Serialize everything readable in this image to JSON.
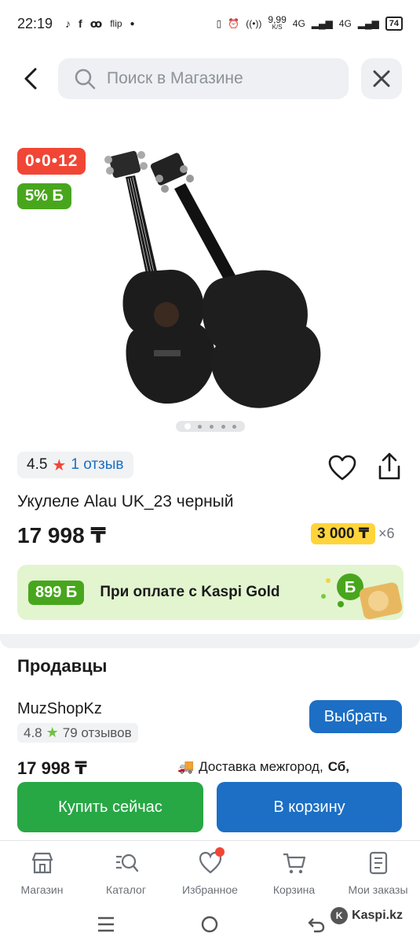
{
  "status_bar": {
    "time": "22:19",
    "app_icons": [
      "tiktok-icon",
      "facebook-icon",
      "ok-icon"
    ],
    "flip_label": "flip",
    "net_speed": "9,99",
    "net_unit": "K/S",
    "signal_1": "4G",
    "signal_2": "4G",
    "battery": "74"
  },
  "search": {
    "placeholder": "Поиск в Магазине"
  },
  "product": {
    "timer": "0•0•12",
    "bonus_badge": "5% Б",
    "rating": "4.5",
    "reviews_link": "1 отзыв",
    "title": "Укулеле Alau UK_23 черный",
    "price": "17 998 ₸",
    "installment_amount": "3 000 ₸",
    "installment_multiplier": "×6",
    "gold_bonus": "899 Б",
    "gold_text": "При оплате с Kaspi Gold",
    "image_dots": 5
  },
  "sellers": {
    "title": "Продавцы",
    "seller_name": "MuzShopKz",
    "seller_rating": "4.8",
    "seller_reviews": "79 отзывов",
    "choose_label": "Выбрать",
    "seller_price": "17 998 ₸",
    "delivery_label": "Доставка межгород,",
    "delivery_day": "Сб,"
  },
  "actions": {
    "buy_now": "Купить сейчас",
    "to_cart": "В корзину"
  },
  "bottom_nav": {
    "items": [
      {
        "label": "Магазин",
        "icon": "shop-icon"
      },
      {
        "label": "Каталог",
        "icon": "catalog-icon"
      },
      {
        "label": "Избранное",
        "icon": "heart-icon"
      },
      {
        "label": "Корзина",
        "icon": "cart-icon"
      },
      {
        "label": "Мои заказы",
        "icon": "orders-icon"
      }
    ]
  },
  "watermark": "Kaspi.kz",
  "colors": {
    "red": "#f14635",
    "green": "#48a61d",
    "blue": "#1c6fc4",
    "buy_green": "#28a745",
    "yellow": "#ffd43b",
    "gold_bg": "#e2f5cf"
  }
}
